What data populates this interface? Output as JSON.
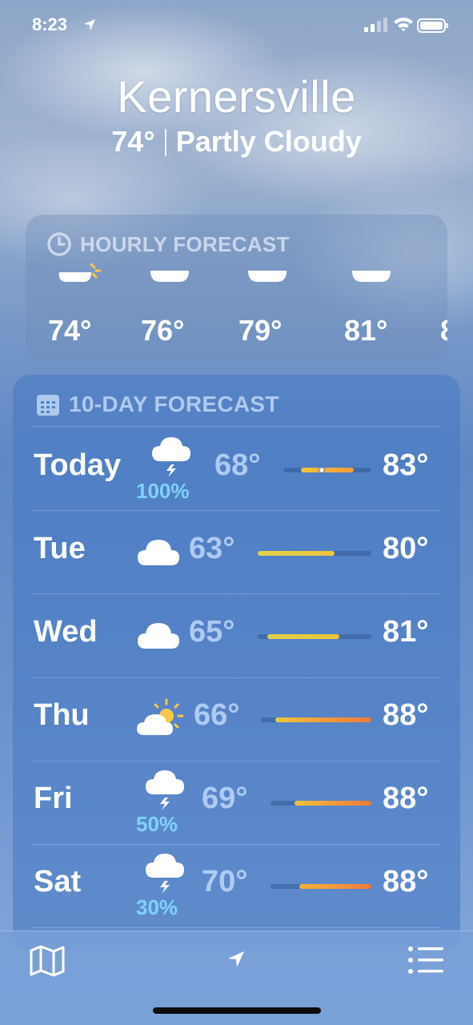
{
  "status_bar": {
    "time": "8:23"
  },
  "header": {
    "city": "Kernersville",
    "current_temp": "74°",
    "condition": "Partly Cloudy"
  },
  "hourly": {
    "title": "HOURLY FORECAST",
    "icon": "clock-icon",
    "items": [
      {
        "temp": "74°",
        "icon": "partly-cloudy-icon"
      },
      {
        "temp": "76°",
        "icon": "cloud-icon"
      },
      {
        "temp": "79°",
        "icon": "cloud-icon"
      },
      {
        "temp": "81°",
        "icon": "cloud-icon"
      }
    ]
  },
  "daily": {
    "title": "10-DAY FORECAST",
    "icon": "calendar-icon",
    "days": [
      {
        "day": "Today",
        "icon": "thunderstorm-icon",
        "precip": "100%",
        "low": "68°",
        "high": "83°"
      },
      {
        "day": "Tue",
        "icon": "cloud-icon",
        "precip": "",
        "low": "63°",
        "high": "80°"
      },
      {
        "day": "Wed",
        "icon": "cloud-icon",
        "precip": "",
        "low": "65°",
        "high": "81°"
      },
      {
        "day": "Thu",
        "icon": "partly-sunny-icon",
        "precip": "",
        "low": "66°",
        "high": "88°"
      },
      {
        "day": "Fri",
        "icon": "thunderstorm-icon",
        "precip": "50%",
        "low": "69°",
        "high": "88°"
      },
      {
        "day": "Sat",
        "icon": "thunderstorm-icon",
        "precip": "30%",
        "low": "70°",
        "high": "88°"
      }
    ]
  },
  "toolbar": {
    "left_icon": "map-icon",
    "center_icon": "location-arrow-icon",
    "right_icon": "list-icon"
  }
}
